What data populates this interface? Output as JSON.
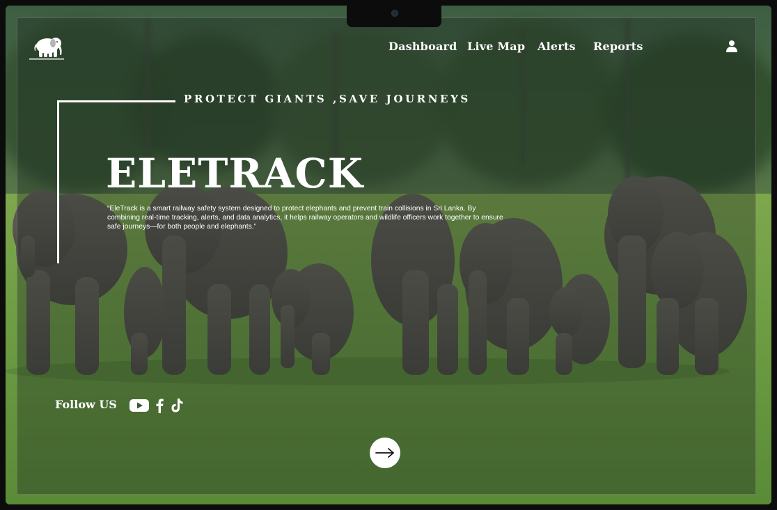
{
  "brand": {
    "logo_icon": "elephant-logo-icon"
  },
  "nav": {
    "items": [
      {
        "label": "Dashboard"
      },
      {
        "label": "Live Map"
      },
      {
        "label": "Alerts"
      },
      {
        "label": "Reports"
      }
    ],
    "profile_icon": "user-icon"
  },
  "hero": {
    "tagline": "PROTECT GIANTS ,SAVE JOURNEYS",
    "title": "ELETRACK",
    "description": "“EleTrack is a smart railway safety system designed to protect elephants and prevent train collisions in Sri Lanka. By combining real-time tracking, alerts, and data analytics, it helps railway operators and wildlife officers work together to ensure safe journeys—for both people and elephants.”"
  },
  "social": {
    "label": "Follow US",
    "icons": [
      "youtube-icon",
      "facebook-icon",
      "tiktok-icon"
    ]
  },
  "cta": {
    "icon": "arrow-right-icon"
  },
  "colors": {
    "text": "#ffffff",
    "overlay": "#1c2822",
    "grass": "#6e9d44",
    "elephant": "#5e5a55"
  }
}
